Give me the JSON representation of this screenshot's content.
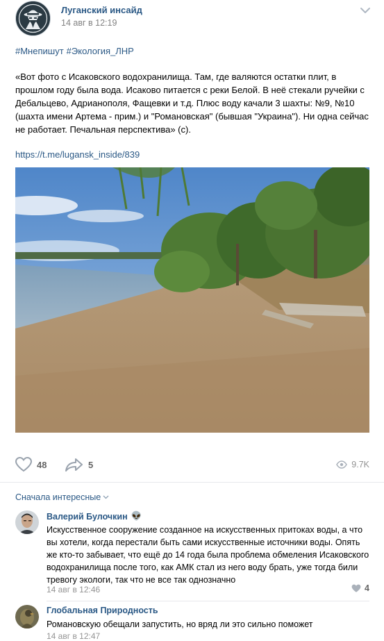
{
  "post": {
    "author": "Луганский инсайд",
    "date": "14 авг в 12:19",
    "hashtags": [
      "#Мнепишут",
      "#Экология_ЛНР"
    ],
    "text": "«Вот фото с Исаковского водохранилища. Там, где валяются остатки плит, в прошлом году была вода. Исаково питается с реки Белой. В неё стекали ручейки с Дебальцево, Адрианополя, Фащевки и т.д. Плюс воду качали 3 шахты: №9, №10 (шахта имени Артема - прим.) и \"Романовская\" (бывшая \"Украина\"). Ни одна сейчас не работает. Печальная перспектива» (с).",
    "link": "https://t.me/lugansk_inside/839",
    "likes": "48",
    "shares": "5",
    "views": "9.7K"
  },
  "comments": {
    "sort_label": "Сначала интересные",
    "items": [
      {
        "author": "Валерий Булочкин",
        "author_emoji": "👽",
        "text": "Искусственное сооружение созданное на искусственных притоках воды, а что вы хотели, когда перестали быть сами искусственные источники воды. Опять же кто-то забывает, что ещё до 14 года была проблема обмеления Исаковского водохранилища после того, как АМК стал из него воду брать, уже тогда били тревогу экологи, так что не все так однозначно",
        "date": "14 авг в 12:46",
        "likes": "4"
      },
      {
        "author": "Глобальная Природность",
        "text": "Романовскую обещали запустить, но вряд ли это сильно поможет",
        "date": "14 авг в 12:47"
      }
    ]
  },
  "colors": {
    "link": "#2a5885",
    "secondary_text": "#828282",
    "divider": "#e7e8ec"
  },
  "icons": [
    "chevron-down-icon",
    "heart-icon",
    "share-icon",
    "eye-icon"
  ]
}
